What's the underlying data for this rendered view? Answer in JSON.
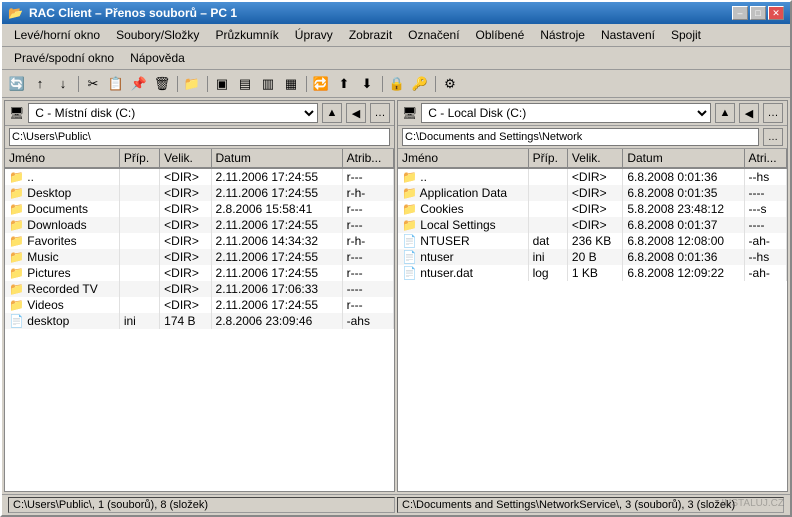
{
  "window": {
    "title": "RAC Client – Přenos souborů – PC 1",
    "min_label": "–",
    "max_label": "□",
    "close_label": "✕"
  },
  "menus": {
    "row1": [
      "Levé/horní okno",
      "Soubory/Složky",
      "Průzkumník",
      "Úpravy",
      "Zobrazit",
      "Označení",
      "Oblíbené",
      "Nástroje",
      "Nastavení",
      "Spojit"
    ],
    "row2": [
      "Pravé/spodní okno",
      "Nápověda"
    ]
  },
  "toolbar": {
    "buttons": [
      "🔄",
      "⬆",
      "⬆",
      "🔄",
      "✂",
      "📋",
      "📋",
      "🗑",
      "📁",
      "📋",
      "⬛",
      "⬛",
      "⬛",
      "⬛",
      "⬛",
      "⬛",
      "⬛",
      "⬛",
      "⬛",
      "⬛",
      "⬛",
      "⬛",
      "⬛",
      "⬛",
      "⬛",
      "⬛",
      "⬛",
      "⬛",
      "⬛",
      "⬛",
      "⬛",
      "⚙"
    ]
  },
  "left_pane": {
    "drive_label": "C - Místní disk (C:)",
    "path": "C:\\Users\\Public\\",
    "columns": [
      "Jméno",
      "Příp.",
      "Velik.",
      "Datum",
      "Atrib..."
    ],
    "files": [
      {
        "icon": "folder",
        "name": "..",
        "ext": "",
        "size": "<DIR>",
        "date": "2.11.2006 17:24:55",
        "attr": "r---"
      },
      {
        "icon": "folder",
        "name": "Desktop",
        "ext": "",
        "size": "<DIR>",
        "date": "2.11.2006 17:24:55",
        "attr": "r-h-"
      },
      {
        "icon": "folder",
        "name": "Documents",
        "ext": "",
        "size": "<DIR>",
        "date": "2.8.2006 15:58:41",
        "attr": "r---"
      },
      {
        "icon": "folder",
        "name": "Downloads",
        "ext": "",
        "size": "<DIR>",
        "date": "2.11.2006 17:24:55",
        "attr": "r---"
      },
      {
        "icon": "folder",
        "name": "Favorites",
        "ext": "",
        "size": "<DIR>",
        "date": "2.11.2006 14:34:32",
        "attr": "r-h-"
      },
      {
        "icon": "music",
        "name": "Music",
        "ext": "",
        "size": "<DIR>",
        "date": "2.11.2006 17:24:55",
        "attr": "r---"
      },
      {
        "icon": "folder",
        "name": "Pictures",
        "ext": "",
        "size": "<DIR>",
        "date": "2.11.2006 17:24:55",
        "attr": "r---"
      },
      {
        "icon": "tv",
        "name": "Recorded TV",
        "ext": "",
        "size": "<DIR>",
        "date": "2.11.2006 17:06:33",
        "attr": "----"
      },
      {
        "icon": "folder",
        "name": "Videos",
        "ext": "",
        "size": "<DIR>",
        "date": "2.11.2006 17:24:55",
        "attr": "r---"
      },
      {
        "icon": "file",
        "name": "desktop",
        "ext": "ini",
        "size": "174 B",
        "date": "2.8.2006 23:09:46",
        "attr": "-ahs"
      }
    ],
    "status": "C:\\Users\\Public\\, 1 (souborů), 8 (složek)"
  },
  "right_pane": {
    "drive_label": "C - Local Disk (C:)",
    "path": "C:\\Documents and Settings\\Network",
    "columns": [
      "Jméno",
      "Příp.",
      "Velik.",
      "Datum",
      "Atri..."
    ],
    "files": [
      {
        "icon": "folder",
        "name": "..",
        "ext": "",
        "size": "<DIR>",
        "date": "6.8.2008 0:01:36",
        "attr": "--hs"
      },
      {
        "icon": "folder-yellow",
        "name": "Application Data",
        "ext": "",
        "size": "<DIR>",
        "date": "6.8.2008 0:01:35",
        "attr": "----"
      },
      {
        "icon": "folder",
        "name": "Cookies",
        "ext": "",
        "size": "<DIR>",
        "date": "5.8.2008 23:48:12",
        "attr": "---s"
      },
      {
        "icon": "folder-yellow",
        "name": "Local Settings",
        "ext": "",
        "size": "<DIR>",
        "date": "6.8.2008 0:01:37",
        "attr": "----"
      },
      {
        "icon": "file",
        "name": "NTUSER",
        "ext": "dat",
        "size": "236 KB",
        "date": "6.8.2008 12:08:00",
        "attr": "-ah-"
      },
      {
        "icon": "file",
        "name": "ntuser",
        "ext": "ini",
        "size": "20 B",
        "date": "6.8.2008 0:01:36",
        "attr": "--hs"
      },
      {
        "icon": "file",
        "name": "ntuser.dat",
        "ext": "log",
        "size": "1 KB",
        "date": "6.8.2008 12:09:22",
        "attr": "-ah-"
      }
    ],
    "status": "C:\\Documents and Settings\\NetworkService\\, 3 (souborů), 3 (složek)"
  },
  "watermark": "INSTALUJ.CZ"
}
